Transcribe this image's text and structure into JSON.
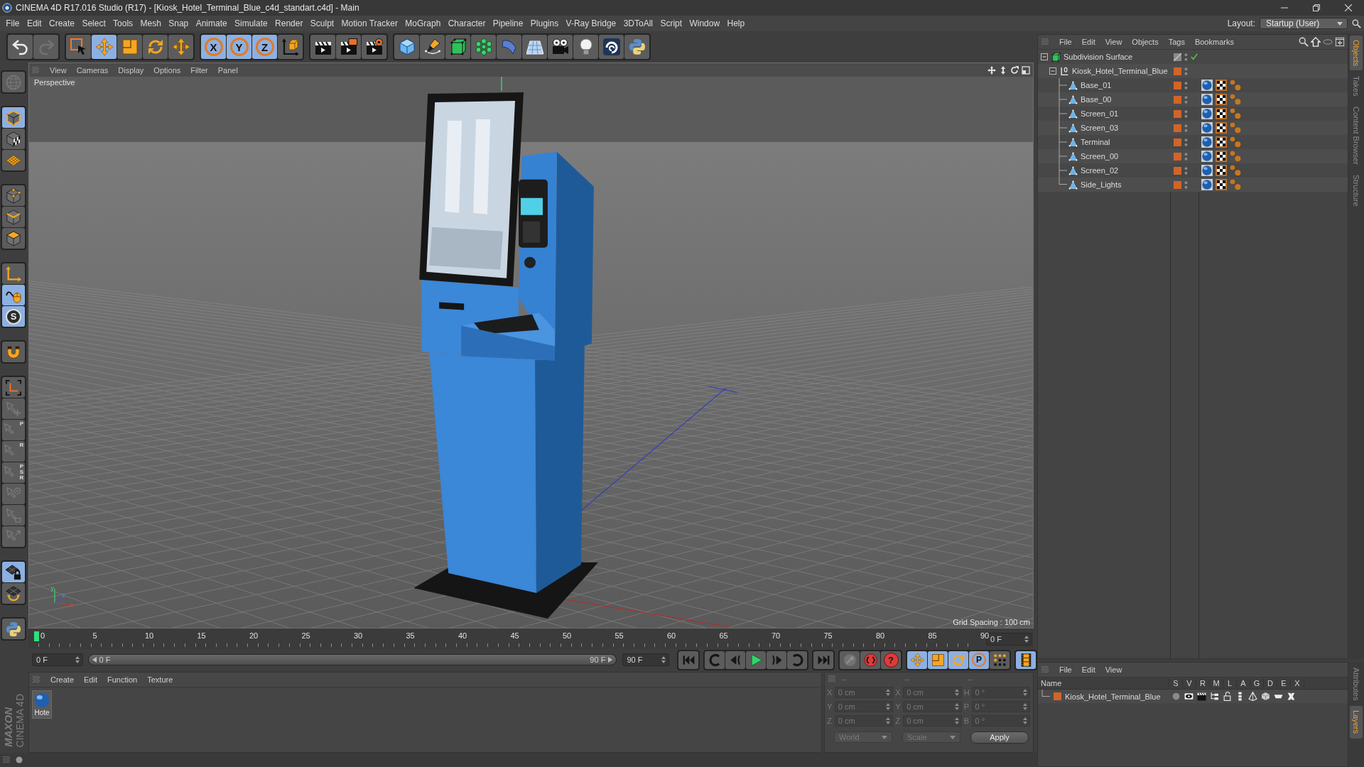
{
  "window": {
    "title": "CINEMA 4D R17.016 Studio (R17) - [Kiosk_Hotel_Terminal_Blue_c4d_standart.c4d] - Main"
  },
  "menu_bar": {
    "items": [
      "File",
      "Edit",
      "Create",
      "Select",
      "Tools",
      "Mesh",
      "Snap",
      "Animate",
      "Simulate",
      "Render",
      "Sculpt",
      "Motion Tracker",
      "MoGraph",
      "Character",
      "Pipeline",
      "Plugins",
      "V-Ray Bridge",
      "3DToAll",
      "Script",
      "Window",
      "Help"
    ],
    "layout_label": "Layout:",
    "layout_value": "Startup (User)"
  },
  "toolbar": {
    "groups": [
      [
        {
          "kind": "undo",
          "selected": false,
          "disabled": false
        },
        {
          "kind": "redo",
          "selected": false,
          "disabled": true
        }
      ],
      [
        {
          "kind": "live-select",
          "selected": false,
          "disabled": false
        },
        {
          "kind": "move",
          "selected": true,
          "disabled": false
        },
        {
          "kind": "scale",
          "selected": false,
          "disabled": false
        },
        {
          "kind": "rotate",
          "selected": false,
          "disabled": false
        },
        {
          "kind": "move",
          "selected": false,
          "disabled": false
        }
      ],
      [
        {
          "kind": "axis-lock",
          "label": "X",
          "selected": true,
          "disabled": false
        },
        {
          "kind": "axis-lock",
          "label": "Y",
          "selected": true,
          "disabled": false
        },
        {
          "kind": "axis-lock",
          "label": "Z",
          "selected": true,
          "disabled": false
        },
        {
          "kind": "coord-system",
          "selected": false,
          "disabled": false
        }
      ],
      [
        {
          "kind": "render-view",
          "selected": false,
          "disabled": false
        },
        {
          "kind": "render-picture",
          "selected": false,
          "disabled": false
        },
        {
          "kind": "render-settings",
          "selected": false,
          "disabled": false
        }
      ],
      [
        {
          "kind": "cube",
          "selected": false,
          "disabled": false
        },
        {
          "kind": "pen",
          "selected": false,
          "disabled": false
        },
        {
          "kind": "subdivision",
          "selected": false,
          "disabled": false
        },
        {
          "kind": "cloner",
          "selected": false,
          "disabled": false
        },
        {
          "kind": "deformer",
          "selected": false,
          "disabled": false
        },
        {
          "kind": "floor",
          "selected": false,
          "disabled": false
        },
        {
          "kind": "camera",
          "selected": false,
          "disabled": false
        },
        {
          "kind": "light",
          "selected": false,
          "disabled": false
        },
        {
          "kind": "vray",
          "selected": false,
          "disabled": false
        },
        {
          "kind": "python",
          "selected": false,
          "disabled": false
        }
      ]
    ]
  },
  "left_toolbar": {
    "groups": [
      [
        {
          "kind": "make-editable",
          "selected": false,
          "disabled": true
        }
      ],
      [
        {
          "kind": "model-mode",
          "selected": true,
          "disabled": false
        },
        {
          "kind": "texture-mode",
          "selected": false,
          "disabled": false
        },
        {
          "kind": "workplane-mode",
          "selected": false,
          "disabled": false
        }
      ],
      [
        {
          "kind": "points-mode",
          "selected": false,
          "disabled": false
        },
        {
          "kind": "edges-mode",
          "selected": false,
          "disabled": false
        },
        {
          "kind": "polygons-mode",
          "selected": false,
          "disabled": false
        }
      ],
      [
        {
          "kind": "axis-mode",
          "selected": false,
          "disabled": false
        },
        {
          "kind": "tweak-mode",
          "selected": true,
          "disabled": false
        },
        {
          "kind": "solo",
          "label": "S",
          "selected": true,
          "disabled": false
        }
      ],
      [
        {
          "kind": "snap",
          "selected": false,
          "disabled": false
        }
      ],
      [
        {
          "kind": "workplane",
          "selected": false,
          "disabled": false
        },
        {
          "kind": "pin-move",
          "selected": false,
          "disabled": true
        },
        {
          "kind": "pin",
          "label": "P",
          "selected": false,
          "disabled": true
        },
        {
          "kind": "pin",
          "label": "R",
          "selected": false,
          "disabled": true
        },
        {
          "kind": "pin",
          "label": "PSR",
          "selected": false,
          "disabled": true
        },
        {
          "kind": "pin-target",
          "selected": false,
          "disabled": true
        },
        {
          "kind": "pin-box",
          "selected": false,
          "disabled": true
        },
        {
          "kind": "pin-arrow",
          "selected": false,
          "disabled": true
        }
      ],
      [
        {
          "kind": "grid-lock",
          "selected": true,
          "disabled": false
        },
        {
          "kind": "grid-rotate",
          "selected": false,
          "disabled": false
        }
      ],
      [
        {
          "kind": "python",
          "selected": false,
          "disabled": false
        }
      ]
    ]
  },
  "brand": {
    "maker": "MAXON",
    "product": "CINEMA 4D"
  },
  "viewport": {
    "menu": [
      "View",
      "Cameras",
      "Display",
      "Options",
      "Filter",
      "Panel"
    ],
    "camera": "Perspective",
    "grid_spacing": "Grid Spacing : 100 cm",
    "gizmo_labels": [
      "y",
      "z",
      "x"
    ]
  },
  "timeline": {
    "ticks": [
      "0",
      "5",
      "10",
      "15",
      "20",
      "25",
      "30",
      "35",
      "40",
      "45",
      "50",
      "55",
      "60",
      "65",
      "70",
      "75",
      "80",
      "85",
      "90"
    ],
    "playhead": {
      "level": 0
    },
    "current_frame": "0 F"
  },
  "transport": {
    "start_field": "0 F",
    "range": {
      "level": 1
    },
    "range_start": "0 F",
    "range_end": "90 F",
    "end_field": "90 F",
    "groups": [
      [
        {
          "kind": "go-start",
          "selected": false,
          "disabled": false
        }
      ],
      [
        {
          "kind": "prev-key",
          "selected": false,
          "disabled": false
        },
        {
          "kind": "prev-frame",
          "selected": false,
          "disabled": false
        },
        {
          "kind": "play",
          "selected": false,
          "disabled": false
        },
        {
          "kind": "next-frame",
          "selected": false,
          "disabled": false
        },
        {
          "kind": "next-key",
          "selected": false,
          "disabled": false
        }
      ],
      [
        {
          "kind": "go-end",
          "selected": false,
          "disabled": false
        }
      ],
      [
        {
          "kind": "keyframe",
          "selected": false,
          "disabled": true
        },
        {
          "kind": "record",
          "selected": false,
          "disabled": false
        },
        {
          "kind": "autokey",
          "label": "?",
          "selected": false,
          "disabled": false
        }
      ],
      [
        {
          "kind": "move",
          "selected": true,
          "disabled": false
        },
        {
          "kind": "scale",
          "selected": true,
          "disabled": false
        },
        {
          "kind": "rotate",
          "selected": true,
          "disabled": false
        },
        {
          "kind": "param",
          "label": "P",
          "selected": true,
          "disabled": false
        },
        {
          "kind": "point-level",
          "selected": false,
          "disabled": false
        }
      ],
      [
        {
          "kind": "timeline",
          "selected": true,
          "disabled": false
        }
      ]
    ]
  },
  "material_manager": {
    "menu": [
      "Create",
      "Edit",
      "Function",
      "Texture"
    ],
    "materials": [
      {
        "name": "Hote",
        "selected": false
      }
    ]
  },
  "coordinates": {
    "disabled": true,
    "headers": [
      "--",
      "--",
      "--"
    ],
    "rows": [
      [
        {
          "axis": "X",
          "value": "0 cm"
        },
        {
          "axis": "X",
          "value": "0 cm"
        },
        {
          "axis": "H",
          "value": "0 °"
        }
      ],
      [
        {
          "axis": "Y",
          "value": "0 cm"
        },
        {
          "axis": "Y",
          "value": "0 cm"
        },
        {
          "axis": "P",
          "value": "0 °"
        }
      ],
      [
        {
          "axis": "Z",
          "value": "0 cm"
        },
        {
          "axis": "Z",
          "value": "0 cm"
        },
        {
          "axis": "B",
          "value": "0 °"
        }
      ]
    ],
    "dropdowns": [
      "World",
      "Scale"
    ],
    "apply": "Apply"
  },
  "object_manager": {
    "menu": [
      "File",
      "Edit",
      "View",
      "Objects",
      "Tags",
      "Bookmarks"
    ],
    "objects": [
      {
        "name": "Subdivision Surface",
        "kind": "generator",
        "expanded": true,
        "selected": false,
        "enabled": true,
        "children": [
          {
            "name": "Kiosk_Hotel_Terminal_Blue",
            "kind": "null",
            "expanded": true,
            "selected": false,
            "color": "#d0652a",
            "children": [
              {
                "name": "Base_01",
                "kind": "polygon",
                "selected": false,
                "color": "#d0652a",
                "tags": [
                  {
                    "kind": "material"
                  },
                  {
                    "kind": "texture"
                  },
                  {
                    "kind": "uvw"
                  }
                ]
              },
              {
                "name": "Base_00",
                "kind": "polygon",
                "selected": false,
                "color": "#d0652a",
                "tags": [
                  {
                    "kind": "material"
                  },
                  {
                    "kind": "texture"
                  },
                  {
                    "kind": "uvw"
                  }
                ]
              },
              {
                "name": "Screen_01",
                "kind": "polygon",
                "selected": false,
                "color": "#d0652a",
                "tags": [
                  {
                    "kind": "material"
                  },
                  {
                    "kind": "texture"
                  },
                  {
                    "kind": "uvw"
                  }
                ]
              },
              {
                "name": "Screen_03",
                "kind": "polygon",
                "selected": false,
                "color": "#d0652a",
                "tags": [
                  {
                    "kind": "material"
                  },
                  {
                    "kind": "texture"
                  },
                  {
                    "kind": "uvw"
                  }
                ]
              },
              {
                "name": "Terminal",
                "kind": "polygon",
                "selected": false,
                "color": "#d0652a",
                "tags": [
                  {
                    "kind": "material"
                  },
                  {
                    "kind": "texture"
                  },
                  {
                    "kind": "uvw"
                  }
                ]
              },
              {
                "name": "Screen_00",
                "kind": "polygon",
                "selected": false,
                "color": "#d0652a",
                "tags": [
                  {
                    "kind": "material"
                  },
                  {
                    "kind": "texture"
                  },
                  {
                    "kind": "uvw"
                  }
                ]
              },
              {
                "name": "Screen_02",
                "kind": "polygon",
                "selected": false,
                "color": "#d0652a",
                "tags": [
                  {
                    "kind": "material"
                  },
                  {
                    "kind": "texture"
                  },
                  {
                    "kind": "uvw"
                  }
                ]
              },
              {
                "name": "Side_Lights",
                "kind": "polygon",
                "selected": false,
                "color": "#d0652a",
                "tags": [
                  {
                    "kind": "material"
                  },
                  {
                    "kind": "texture"
                  },
                  {
                    "kind": "uvw"
                  }
                ]
              }
            ]
          }
        ]
      }
    ]
  },
  "side_tabs": {
    "upper": [
      {
        "label": "Objects",
        "selected": true
      },
      {
        "label": "Takes",
        "selected": false
      },
      {
        "label": "Content Browser",
        "selected": false
      },
      {
        "label": "Structure",
        "selected": false
      }
    ],
    "lower": [
      {
        "label": "Attributes",
        "selected": false
      },
      {
        "label": "Layers",
        "selected": true
      }
    ]
  },
  "layer_manager": {
    "menu": [
      "File",
      "Edit",
      "View"
    ],
    "columns": [
      "Name",
      "S",
      "V",
      "R",
      "M",
      "L",
      "A",
      "G",
      "D",
      "E",
      "X"
    ],
    "layers": [
      {
        "name": "Kiosk_Hotel_Terminal_Blue",
        "color": "#d0652a",
        "selected": false,
        "flags": [
          {
            "kind": "solo",
            "on": false
          },
          {
            "kind": "view",
            "on": true
          },
          {
            "kind": "render",
            "on": true
          },
          {
            "kind": "manager",
            "on": true
          },
          {
            "kind": "locked",
            "on": false
          },
          {
            "kind": "animation",
            "on": true
          },
          {
            "kind": "generators",
            "on": true
          },
          {
            "kind": "deformers",
            "on": true
          },
          {
            "kind": "expressions",
            "on": true
          },
          {
            "kind": "xrefs",
            "on": true
          }
        ]
      }
    ]
  }
}
